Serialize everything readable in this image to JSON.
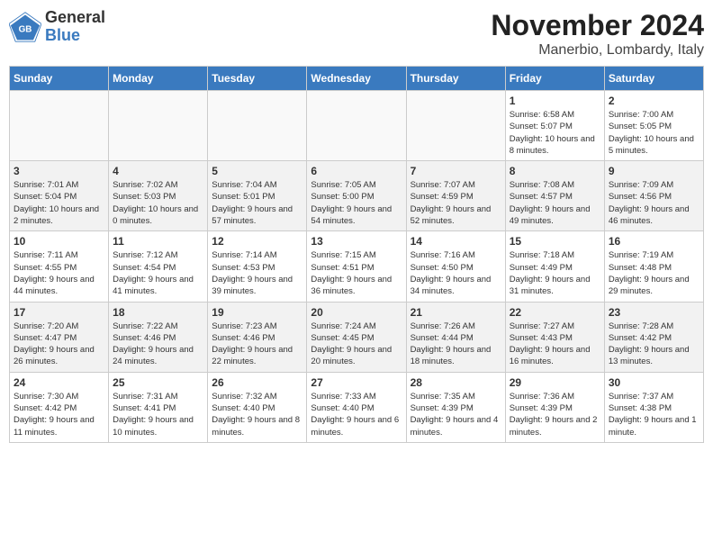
{
  "header": {
    "logo_line1": "General",
    "logo_line2": "Blue",
    "month_title": "November 2024",
    "location": "Manerbio, Lombardy, Italy"
  },
  "weekdays": [
    "Sunday",
    "Monday",
    "Tuesday",
    "Wednesday",
    "Thursday",
    "Friday",
    "Saturday"
  ],
  "weeks": [
    [
      {
        "day": "",
        "info": ""
      },
      {
        "day": "",
        "info": ""
      },
      {
        "day": "",
        "info": ""
      },
      {
        "day": "",
        "info": ""
      },
      {
        "day": "",
        "info": ""
      },
      {
        "day": "1",
        "info": "Sunrise: 6:58 AM\nSunset: 5:07 PM\nDaylight: 10 hours and 8 minutes."
      },
      {
        "day": "2",
        "info": "Sunrise: 7:00 AM\nSunset: 5:05 PM\nDaylight: 10 hours and 5 minutes."
      }
    ],
    [
      {
        "day": "3",
        "info": "Sunrise: 7:01 AM\nSunset: 5:04 PM\nDaylight: 10 hours and 2 minutes."
      },
      {
        "day": "4",
        "info": "Sunrise: 7:02 AM\nSunset: 5:03 PM\nDaylight: 10 hours and 0 minutes."
      },
      {
        "day": "5",
        "info": "Sunrise: 7:04 AM\nSunset: 5:01 PM\nDaylight: 9 hours and 57 minutes."
      },
      {
        "day": "6",
        "info": "Sunrise: 7:05 AM\nSunset: 5:00 PM\nDaylight: 9 hours and 54 minutes."
      },
      {
        "day": "7",
        "info": "Sunrise: 7:07 AM\nSunset: 4:59 PM\nDaylight: 9 hours and 52 minutes."
      },
      {
        "day": "8",
        "info": "Sunrise: 7:08 AM\nSunset: 4:57 PM\nDaylight: 9 hours and 49 minutes."
      },
      {
        "day": "9",
        "info": "Sunrise: 7:09 AM\nSunset: 4:56 PM\nDaylight: 9 hours and 46 minutes."
      }
    ],
    [
      {
        "day": "10",
        "info": "Sunrise: 7:11 AM\nSunset: 4:55 PM\nDaylight: 9 hours and 44 minutes."
      },
      {
        "day": "11",
        "info": "Sunrise: 7:12 AM\nSunset: 4:54 PM\nDaylight: 9 hours and 41 minutes."
      },
      {
        "day": "12",
        "info": "Sunrise: 7:14 AM\nSunset: 4:53 PM\nDaylight: 9 hours and 39 minutes."
      },
      {
        "day": "13",
        "info": "Sunrise: 7:15 AM\nSunset: 4:51 PM\nDaylight: 9 hours and 36 minutes."
      },
      {
        "day": "14",
        "info": "Sunrise: 7:16 AM\nSunset: 4:50 PM\nDaylight: 9 hours and 34 minutes."
      },
      {
        "day": "15",
        "info": "Sunrise: 7:18 AM\nSunset: 4:49 PM\nDaylight: 9 hours and 31 minutes."
      },
      {
        "day": "16",
        "info": "Sunrise: 7:19 AM\nSunset: 4:48 PM\nDaylight: 9 hours and 29 minutes."
      }
    ],
    [
      {
        "day": "17",
        "info": "Sunrise: 7:20 AM\nSunset: 4:47 PM\nDaylight: 9 hours and 26 minutes."
      },
      {
        "day": "18",
        "info": "Sunrise: 7:22 AM\nSunset: 4:46 PM\nDaylight: 9 hours and 24 minutes."
      },
      {
        "day": "19",
        "info": "Sunrise: 7:23 AM\nSunset: 4:46 PM\nDaylight: 9 hours and 22 minutes."
      },
      {
        "day": "20",
        "info": "Sunrise: 7:24 AM\nSunset: 4:45 PM\nDaylight: 9 hours and 20 minutes."
      },
      {
        "day": "21",
        "info": "Sunrise: 7:26 AM\nSunset: 4:44 PM\nDaylight: 9 hours and 18 minutes."
      },
      {
        "day": "22",
        "info": "Sunrise: 7:27 AM\nSunset: 4:43 PM\nDaylight: 9 hours and 16 minutes."
      },
      {
        "day": "23",
        "info": "Sunrise: 7:28 AM\nSunset: 4:42 PM\nDaylight: 9 hours and 13 minutes."
      }
    ],
    [
      {
        "day": "24",
        "info": "Sunrise: 7:30 AM\nSunset: 4:42 PM\nDaylight: 9 hours and 11 minutes."
      },
      {
        "day": "25",
        "info": "Sunrise: 7:31 AM\nSunset: 4:41 PM\nDaylight: 9 hours and 10 minutes."
      },
      {
        "day": "26",
        "info": "Sunrise: 7:32 AM\nSunset: 4:40 PM\nDaylight: 9 hours and 8 minutes."
      },
      {
        "day": "27",
        "info": "Sunrise: 7:33 AM\nSunset: 4:40 PM\nDaylight: 9 hours and 6 minutes."
      },
      {
        "day": "28",
        "info": "Sunrise: 7:35 AM\nSunset: 4:39 PM\nDaylight: 9 hours and 4 minutes."
      },
      {
        "day": "29",
        "info": "Sunrise: 7:36 AM\nSunset: 4:39 PM\nDaylight: 9 hours and 2 minutes."
      },
      {
        "day": "30",
        "info": "Sunrise: 7:37 AM\nSunset: 4:38 PM\nDaylight: 9 hours and 1 minute."
      }
    ]
  ]
}
